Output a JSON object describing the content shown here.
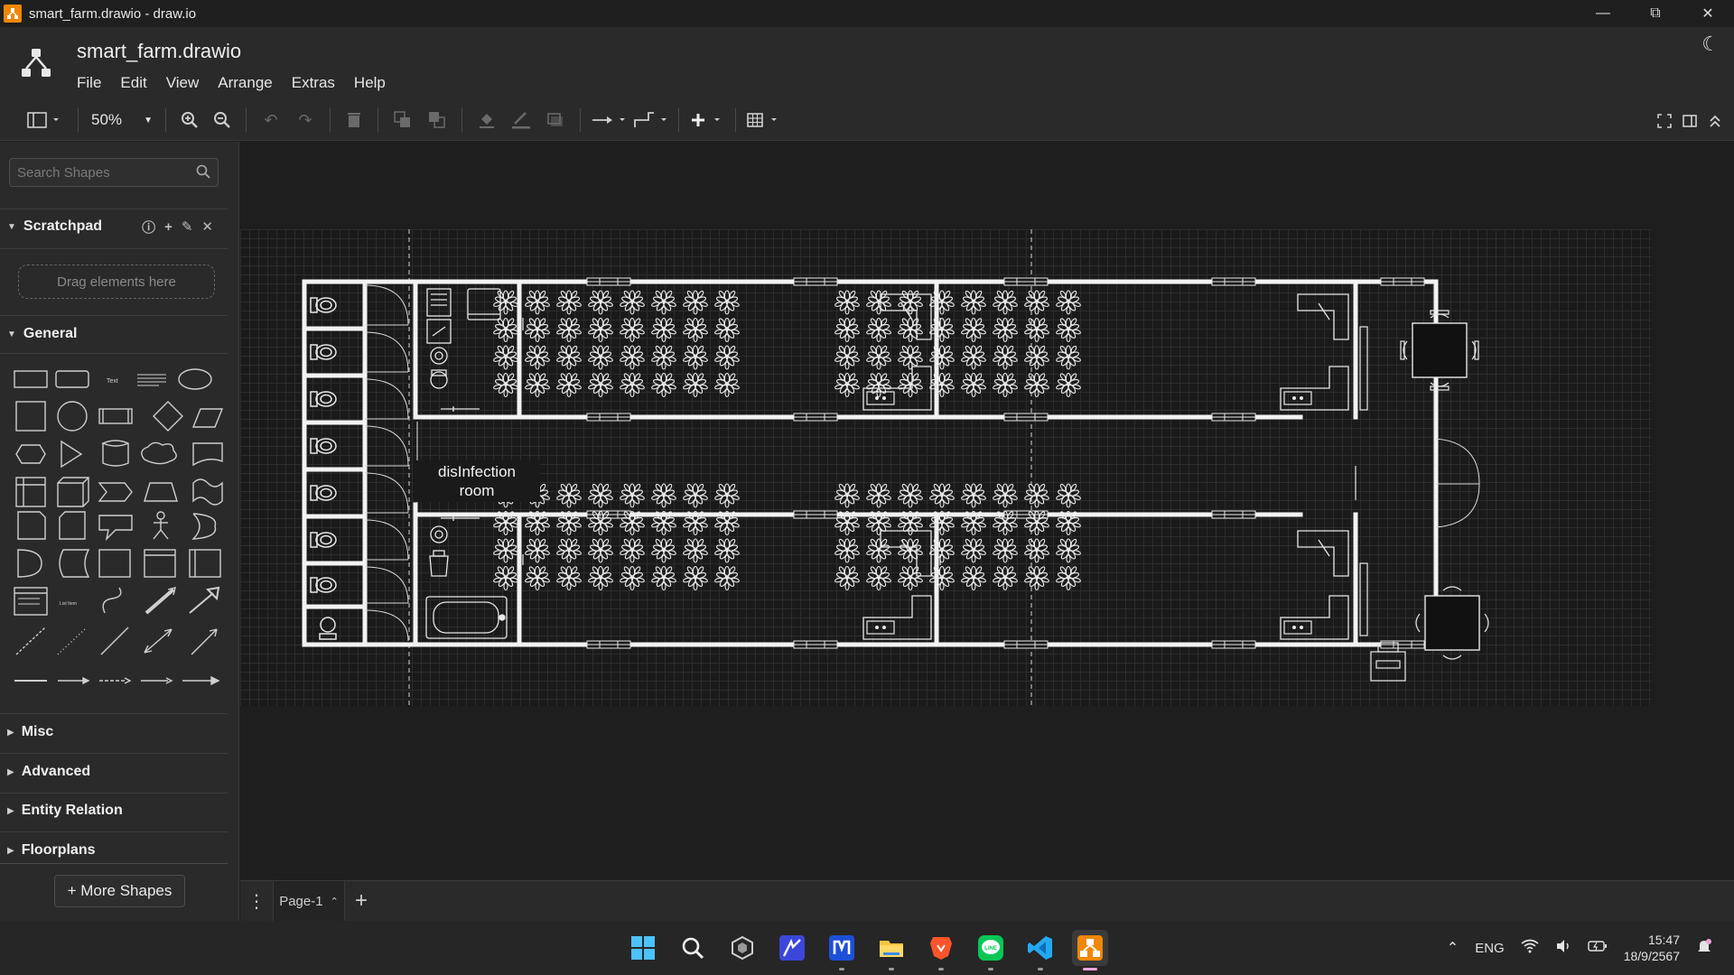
{
  "window": {
    "title": "smart_farm.drawio - draw.io"
  },
  "header": {
    "filename": "smart_farm.drawio",
    "menus": [
      "File",
      "Edit",
      "View",
      "Arrange",
      "Extras",
      "Help"
    ]
  },
  "toolbar": {
    "zoom": "50%"
  },
  "sidebar": {
    "search_placeholder": "Search Shapes",
    "scratchpad": {
      "title": "Scratchpad",
      "dropzone": "Drag elements here"
    },
    "general": {
      "title": "General"
    },
    "sections": [
      "Misc",
      "Advanced",
      "Entity Relation",
      "Floorplans"
    ],
    "more_shapes": "+ More Shapes"
  },
  "diagram": {
    "room_label_line1": "disInfection",
    "room_label_line2": "room"
  },
  "pagebar": {
    "page_tab": "Page-1"
  },
  "taskbar": {
    "apps": [
      "start-icon",
      "search-icon",
      "ai-app-icon",
      "chart-app-icon",
      "app-icon",
      "file-explorer-icon",
      "brave-icon",
      "line-icon",
      "vscode-icon",
      "drawio-icon"
    ],
    "language": "ENG",
    "time": "15:47",
    "date": "18/9/2567"
  },
  "colors": {
    "accent": "#f08705",
    "canvas": "#1a1a1a",
    "wall": "#ffffff"
  }
}
